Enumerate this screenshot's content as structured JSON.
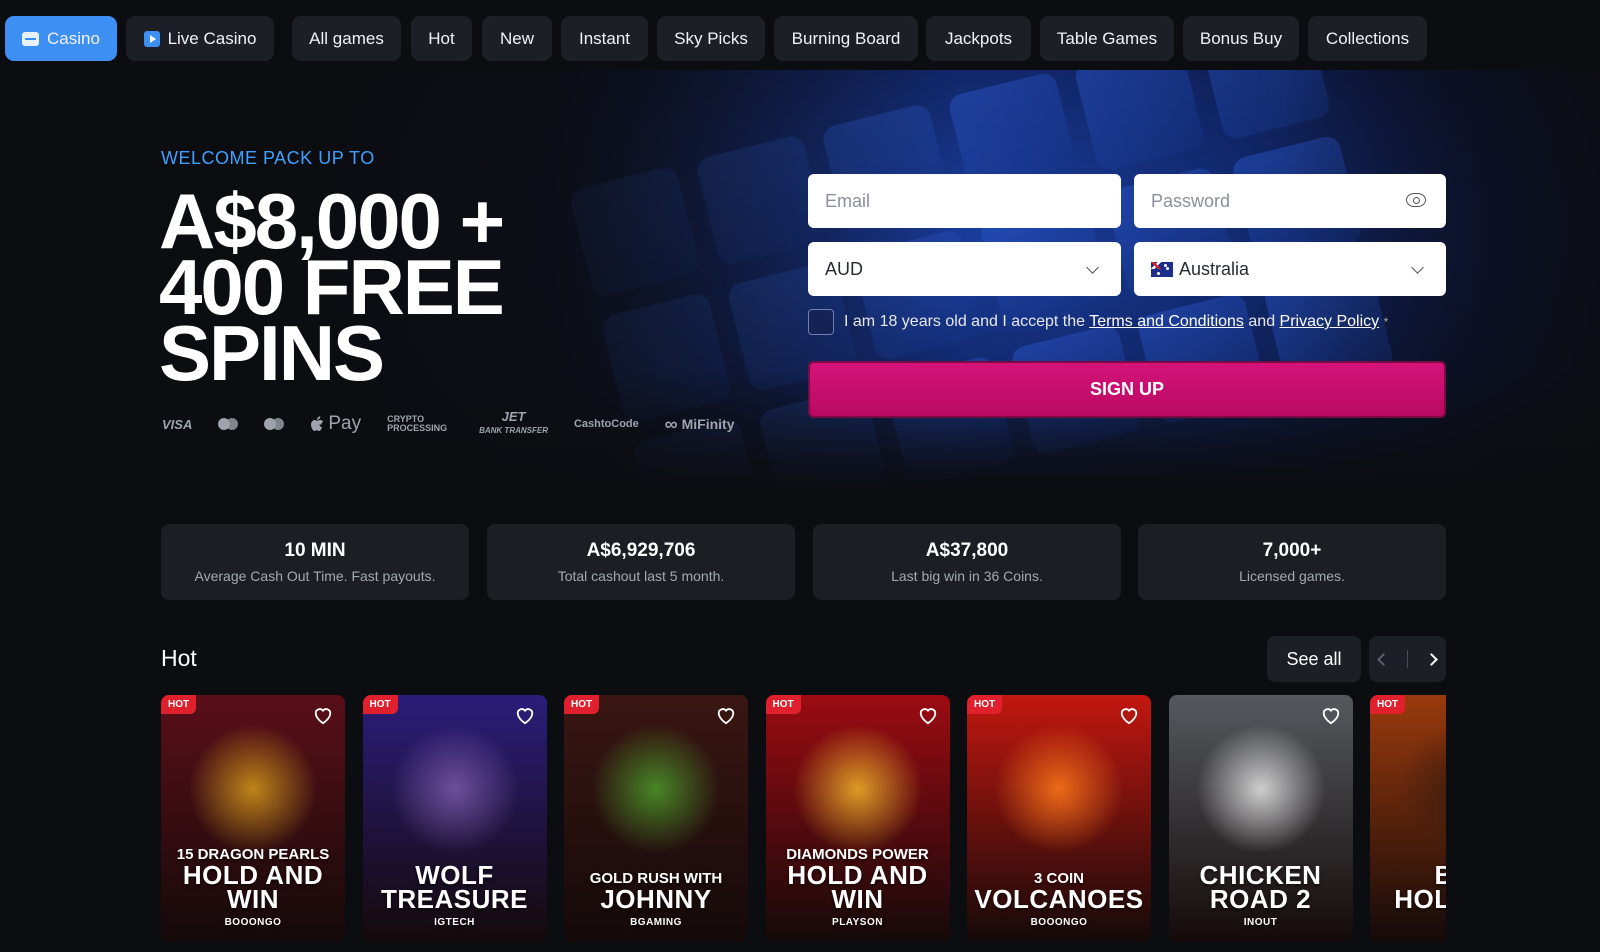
{
  "nav": {
    "casino": "Casino",
    "live_casino": "Live Casino",
    "tabs": [
      "All games",
      "Hot",
      "New",
      "Instant",
      "Sky Picks",
      "Burning Board",
      "Jackpots",
      "Table Games",
      "Bonus Buy",
      "Collections"
    ]
  },
  "hero": {
    "welcome": "WELCOME PACK UP TO",
    "headline_line1": "A$8,000 +",
    "headline_line2": "400 FREE",
    "headline_line3": "SPINS",
    "payments": {
      "visa": "VISA",
      "apple_pay": "Pay",
      "crypto": "CRYPTO PROCESSING",
      "jet": "JET",
      "jet_sub": "BANK TRANSFER",
      "cashtocode": "CashtoCode",
      "mifinity": "MiFinity"
    }
  },
  "form": {
    "email_placeholder": "Email",
    "password_placeholder": "Password",
    "currency": "AUD",
    "country": "Australia",
    "consent_prefix": "I am 18 years old and I accept the",
    "terms_link": "Terms and Conditions",
    "consent_and": "and",
    "privacy_link": "Privacy Policy",
    "required_mark": "*",
    "signup_label": "SIGN UP"
  },
  "stats": [
    {
      "value": "10 MIN",
      "desc": "Average Cash Out Time. Fast payouts."
    },
    {
      "value": "A$6,929,706",
      "desc": "Total cashout last 5 month."
    },
    {
      "value": "A$37,800",
      "desc": "Last big win in 36 Coins."
    },
    {
      "value": "7,000+",
      "desc": "Licensed games."
    }
  ],
  "hot_section": {
    "title": "Hot",
    "see_all": "See all",
    "badge": "HOT",
    "games": [
      {
        "sub": "15 DRAGON PEARLS",
        "main": "HOLD AND WIN",
        "provider": "BOOONGO",
        "hot": true,
        "bg": "#5a0f18",
        "art": "#d49a1a"
      },
      {
        "sub": "",
        "main": "WOLF",
        "main2": "TREASURE",
        "provider": "IGTECH",
        "hot": true,
        "bg": "#2b1d7a",
        "art": "#7a5aa8"
      },
      {
        "sub": "GOLD RUSH WITH",
        "main": "JOHNNY",
        "provider": "BGAMING",
        "hot": true,
        "bg": "#3a1612",
        "art": "#4e9a2b"
      },
      {
        "sub": "DIAMONDS POWER",
        "main": "HOLD AND WIN",
        "provider": "PLAYSON",
        "hot": true,
        "bg": "#9c0b12",
        "art": "#f2b42a"
      },
      {
        "sub": "3 COIN",
        "main": "VOLCANOES",
        "provider": "BOOONGO",
        "hot": true,
        "bg": "#c2170f",
        "art": "#ff7a1a"
      },
      {
        "sub": "",
        "main": "CHICKEN",
        "main2": "ROAD 2",
        "provider": "INOUT",
        "hot": false,
        "bg": "#55595e",
        "art": "#e8e8e8"
      },
      {
        "sub": "",
        "main": "BUF",
        "main2": "HOLD EXT",
        "provider": "BOOM",
        "hot": true,
        "bg": "#9a3a0c",
        "art": "#3a1a10"
      }
    ]
  },
  "colors": {
    "accent": "#3d8ff3",
    "signup": "#c80d6d",
    "welcome_text": "#3fa0ff"
  }
}
